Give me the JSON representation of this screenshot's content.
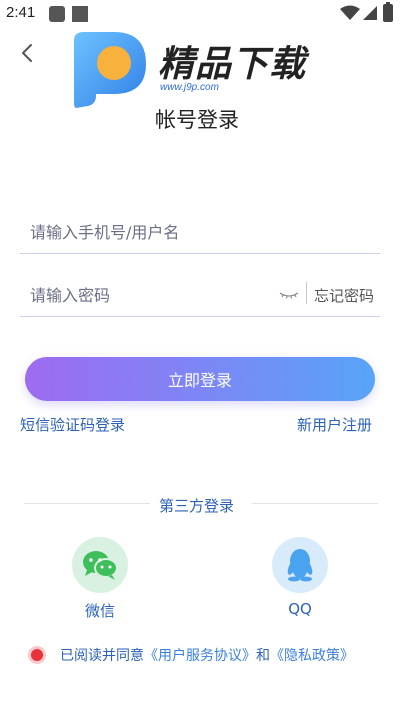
{
  "status_bar": {
    "time": "2:41",
    "icons": [
      "notification-icon",
      "notification-icon",
      "wifi-icon",
      "signal-icon",
      "battery-icon"
    ]
  },
  "header": {
    "back_icon": "chevron-left-icon",
    "logo_text": "精品下载",
    "logo_url": "www.j9p.com",
    "title": "帐号登录"
  },
  "form": {
    "phone_placeholder": "请输入手机号/用户名",
    "phone_value": "",
    "password_placeholder": "请输入密码",
    "password_value": "",
    "eye_icon": "eye-closed-icon",
    "forgot_label": "忘记密码"
  },
  "actions": {
    "login_label": "立即登录",
    "sms_login_label": "短信验证码登录",
    "register_label": "新用户注册"
  },
  "third_party": {
    "title": "第三方登录",
    "options": [
      {
        "label": "微信",
        "icon": "wechat-icon",
        "color": "#3fbf5c"
      },
      {
        "label": "QQ",
        "icon": "qq-icon",
        "color": "#4aa3ee"
      }
    ]
  },
  "agreement": {
    "checked": true,
    "prefix": "已阅读并同意",
    "service_link": "《用户服务协议》",
    "and": "和",
    "privacy_link": "《隐私政策》"
  },
  "colors": {
    "accent_start": "#9e6bf0",
    "accent_end": "#58a4f8",
    "link": "#2d62b8",
    "radio": "#e8333c"
  }
}
